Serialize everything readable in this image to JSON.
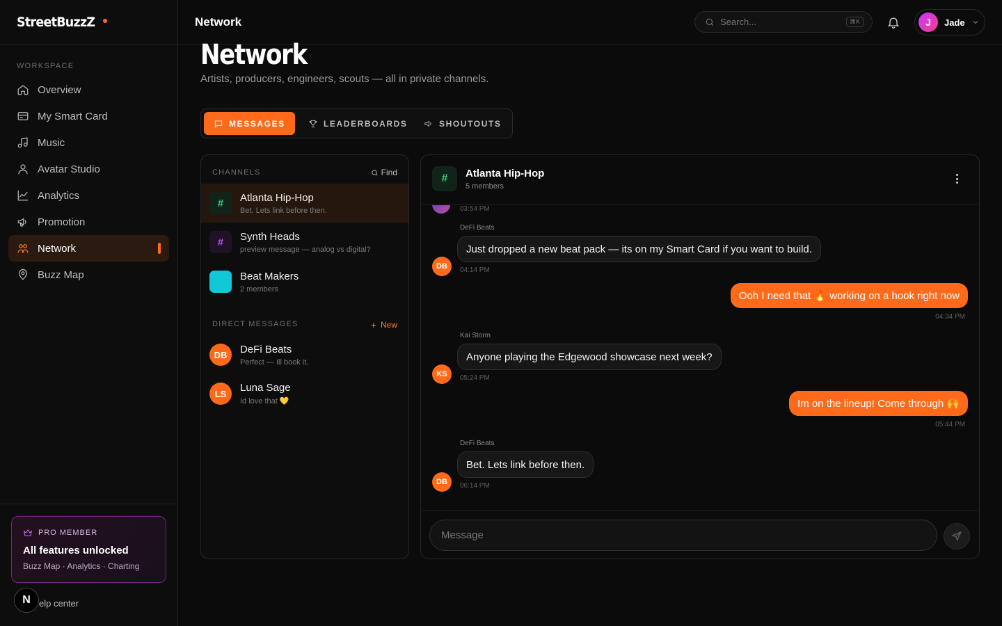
{
  "brand": {
    "name": "StreetBuzzZ"
  },
  "sidebar": {
    "section_label": "WORKSPACE",
    "items": [
      {
        "label": "Overview",
        "icon": "home-icon"
      },
      {
        "label": "My Smart Card",
        "icon": "card-icon"
      },
      {
        "label": "Music",
        "icon": "music-icon"
      },
      {
        "label": "Avatar Studio",
        "icon": "user-icon"
      },
      {
        "label": "Analytics",
        "icon": "chart-icon"
      },
      {
        "label": "Promotion",
        "icon": "megaphone-icon"
      },
      {
        "label": "Network",
        "icon": "users-icon",
        "active": true
      },
      {
        "label": "Buzz Map",
        "icon": "map-pin-icon"
      }
    ],
    "pro": {
      "badge": "PRO MEMBER",
      "title": "All features unlocked",
      "subtitle": "Buzz Map · Analytics · Charting"
    },
    "help": "elp center",
    "n_badge": "N"
  },
  "topbar": {
    "title": "Network",
    "search_placeholder": "Search...",
    "shortcut": "⌘K",
    "user": {
      "initial": "J",
      "name": "Jade"
    }
  },
  "page": {
    "title": "Network",
    "subtitle": "Artists, producers, engineers, scouts — all in private channels."
  },
  "tabs": [
    {
      "label": "MESSAGES",
      "active": true
    },
    {
      "label": "LEADERBOARDS"
    },
    {
      "label": "SHOUTOUTS"
    }
  ],
  "channels": {
    "label": "CHANNELS",
    "find": "Find",
    "items": [
      {
        "name": "Atlanta Hip-Hop",
        "preview": "Bet. Lets link before then.",
        "icon": "#",
        "active": true
      },
      {
        "name": "Synth Heads",
        "preview": "preview message — analog vs digital?",
        "icon": "#"
      },
      {
        "name": "Beat Makers",
        "preview": "2 members",
        "icon": ""
      }
    ],
    "dm_label": "DIRECT MESSAGES",
    "new_label": "New",
    "dms": [
      {
        "initials": "DB",
        "name": "DeFi Beats",
        "preview": "Perfect — Ill book it."
      },
      {
        "initials": "LS",
        "name": "Luna Sage",
        "preview": "Id love that 💛"
      }
    ]
  },
  "chat": {
    "icon": "#",
    "title": "Atlanta Hip-Hop",
    "members": "5 members",
    "messages": [
      {
        "time": "03:54 PM"
      },
      {
        "sender": "DeFi Beats",
        "initials": "DB",
        "text": "Just dropped a new beat pack — its on my Smart Card if you want to build.",
        "time": "04:14 PM"
      },
      {
        "text": "Ooh I need that 🔥 working on a hook right now",
        "time": "04:34 PM"
      },
      {
        "sender": "Kai Storm",
        "initials": "KS",
        "text": "Anyone playing the Edgewood showcase next week?",
        "time": "05:24 PM"
      },
      {
        "text": "Im on the lineup! Come through 🙌",
        "time": "05:44 PM"
      },
      {
        "sender": "DeFi Beats",
        "initials": "DB",
        "text": "Bet. Lets link before then.",
        "time": "06:14 PM"
      }
    ],
    "input_placeholder": "Message"
  },
  "colors": {
    "accent": "#ff6a1a",
    "pro_border": "#6b2a78",
    "channel_green": "#3fd17a",
    "channel_purple": "#c04fff",
    "channel_cyan": "#12c8d8"
  }
}
